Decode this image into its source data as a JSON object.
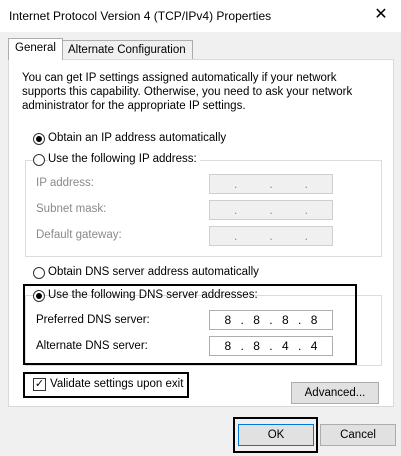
{
  "window": {
    "title": "Internet Protocol Version 4 (TCP/IPv4) Properties",
    "close_glyph": "✕"
  },
  "tabs": [
    {
      "label": "General",
      "active": true
    },
    {
      "label": "Alternate Configuration",
      "active": false
    }
  ],
  "description": "You can get IP settings assigned automatically if your network supports this capability. Otherwise, you need to ask your network administrator for the appropriate IP settings.",
  "ip_section": {
    "auto_option": {
      "label": "Obtain an IP address automatically",
      "selected": true
    },
    "manual_option": {
      "label": "Use the following IP address:",
      "selected": false
    },
    "fields": [
      {
        "label": "IP address:",
        "value": [
          ".",
          ".",
          "."
        ]
      },
      {
        "label": "Subnet mask:",
        "value": [
          ".",
          ".",
          "."
        ]
      },
      {
        "label": "Default gateway:",
        "value": [
          ".",
          ".",
          "."
        ]
      }
    ]
  },
  "dns_section": {
    "auto_option": {
      "label": "Obtain DNS server address automatically",
      "selected": false
    },
    "manual_option": {
      "label": "Use the following DNS server addresses:",
      "selected": true
    },
    "preferred": {
      "label": "Preferred DNS server:",
      "octets": [
        "8",
        "8",
        "8",
        "8"
      ]
    },
    "alternate": {
      "label": "Alternate DNS server:",
      "octets": [
        "8",
        "8",
        "4",
        "4"
      ]
    }
  },
  "validate": {
    "label": "Validate settings upon exit",
    "checked": true,
    "check_glyph": "✓"
  },
  "buttons": {
    "advanced": "Advanced...",
    "ok": "OK",
    "cancel": "Cancel"
  },
  "colors": {
    "accent": "#0078d7",
    "highlight_border": "#000000"
  }
}
